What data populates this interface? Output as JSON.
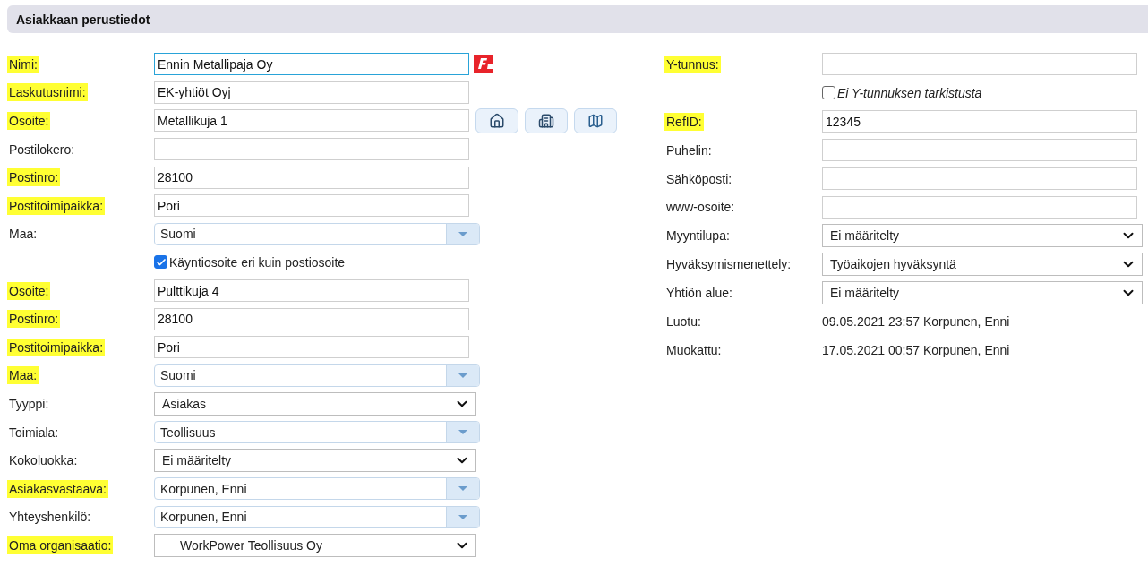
{
  "section": {
    "title": "Asiakkaan perustiedot"
  },
  "left_fields": [
    {
      "kind": "text",
      "label": "Nimi:",
      "highlighted": true,
      "value": "Ennin Metallipaja Oy",
      "focused": true,
      "logo": true
    },
    {
      "kind": "text",
      "label": "Laskutusnimi:",
      "highlighted": true,
      "value": "EK-yhtiöt Oyj",
      "focused": false
    },
    {
      "kind": "text",
      "label": "Osoite:",
      "highlighted": true,
      "value": "Metallikuja 1",
      "focused": false,
      "actions": [
        {
          "kind": "house"
        },
        {
          "kind": "building"
        },
        {
          "kind": "map"
        }
      ]
    },
    {
      "kind": "text",
      "label": "Postilokero:",
      "highlighted": false,
      "focused": false
    },
    {
      "kind": "text",
      "label": "Postinro:",
      "highlighted": true,
      "value": "28100",
      "focused": false
    },
    {
      "kind": "text",
      "label": "Postitoimipaikka:",
      "highlighted": true,
      "value": "Pori",
      "focused": false
    },
    {
      "kind": "combo",
      "label": "Maa:",
      "highlighted": false,
      "value": "Suomi"
    },
    {
      "kind": "checkbox",
      "text": "Käyntiosoite eri kuin postiosoite",
      "checked": true
    },
    {
      "kind": "text",
      "label": "Osoite:",
      "highlighted": true,
      "value": "Pulttikuja 4",
      "focused": false
    },
    {
      "kind": "text",
      "label": "Postinro:",
      "highlighted": true,
      "value": "28100",
      "focused": false
    },
    {
      "kind": "text",
      "label": "Postitoimipaikka:",
      "highlighted": true,
      "value": "Pori",
      "focused": false
    },
    {
      "kind": "combo",
      "label": "Maa:",
      "highlighted": true,
      "value": "Suomi"
    },
    {
      "kind": "select",
      "label": "Tyyppi:",
      "highlighted": false,
      "value": "Asiakas"
    },
    {
      "kind": "combo",
      "label": "Toimiala:",
      "highlighted": false,
      "value": "Teollisuus"
    },
    {
      "kind": "select",
      "label": "Kokoluokka:",
      "highlighted": false,
      "value": "Ei määritelty"
    },
    {
      "kind": "combo",
      "label": "Asiakasvastaava:",
      "highlighted": true,
      "value": "Korpunen, Enni"
    },
    {
      "kind": "combo",
      "label": "Yhteyshenkilö:",
      "highlighted": false,
      "value": "Korpunen, Enni"
    },
    {
      "kind": "select",
      "label": "Oma organisaatio:",
      "highlighted": true,
      "value": "WorkPower Teollisuus Oy",
      "indented": true
    }
  ],
  "right_fields": [
    {
      "kind": "text",
      "label": "Y-tunnus:",
      "highlighted": true,
      "focused": false
    },
    {
      "kind": "checkbox",
      "text": "Ei Y-tunnuksen tarkistusta",
      "checked": false
    },
    {
      "kind": "text",
      "label": "RefID:",
      "highlighted": true,
      "value": "12345",
      "focused": false
    },
    {
      "kind": "text",
      "label": "Puhelin:",
      "highlighted": false,
      "focused": false
    },
    {
      "kind": "text",
      "label": "Sähköposti:",
      "highlighted": false,
      "focused": false
    },
    {
      "kind": "text",
      "label": "www-osoite:",
      "highlighted": false,
      "focused": false
    },
    {
      "kind": "select",
      "label": "Myyntilupa:",
      "highlighted": false,
      "value": "Ei määritelty"
    },
    {
      "kind": "select",
      "label": "Hyväksymismenettely:",
      "highlighted": false,
      "value": "Työaikojen hyväksyntä"
    },
    {
      "kind": "select",
      "label": "Yhtiön alue:",
      "highlighted": false,
      "value": "Ei määritelty"
    },
    {
      "kind": "info",
      "label": "Luotu:",
      "highlighted": false,
      "value": "09.05.2021 23:57 Korpunen, Enni"
    },
    {
      "kind": "info",
      "label": "Muokattu:",
      "highlighted": false,
      "value": "17.05.2021 00:57 Korpunen, Enni"
    }
  ]
}
